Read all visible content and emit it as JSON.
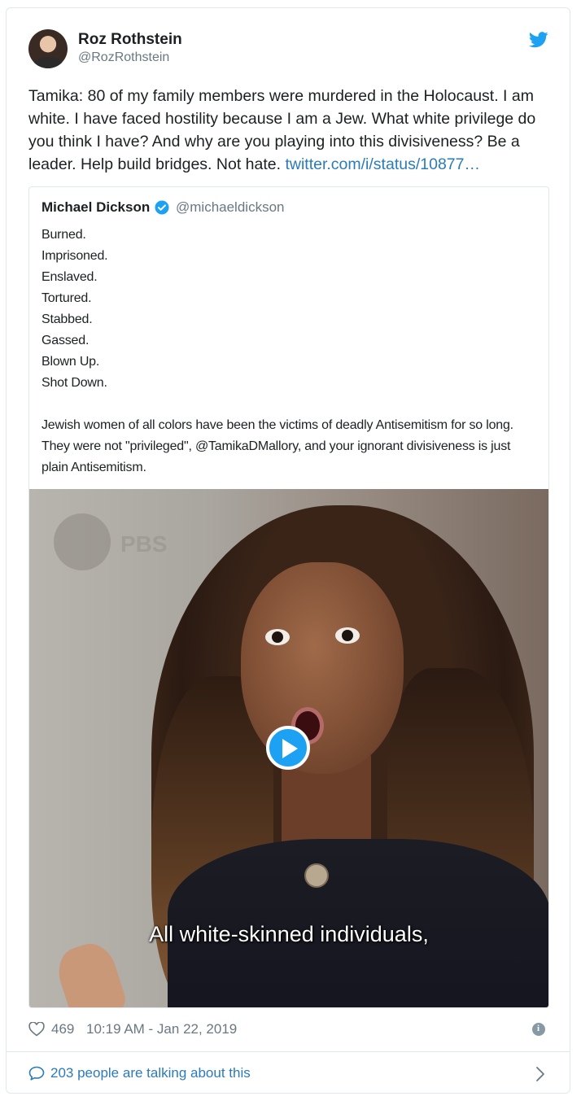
{
  "author": {
    "name": "Roz Rothstein",
    "handle": "@RozRothstein"
  },
  "tweet": {
    "text": "Tamika: 80 of my family members were murdered in the Holocaust. I am white. I have faced hostility because I am a Jew. What white privilege do you think I have? And why are you playing into this divisiveness? Be a leader. Help build bridges. Not hate. ",
    "link": "twitter.com/i/status/10877…"
  },
  "quoted": {
    "name": "Michael Dickson",
    "handle": "@michaeldickson",
    "lines": [
      "Burned.",
      "Imprisoned.",
      "Enslaved.",
      "Tortured.",
      "Stabbed.",
      "Gassed.",
      "Blown Up.",
      "Shot Down."
    ],
    "paragraph": "Jewish women of all colors have been the victims of deadly Antisemitism for so long. They were not \"privileged\", @TamikaDMallory, and your ignorant divisiveness is just plain Antisemitism.",
    "video_caption": "All white-skinned individuals,",
    "video_watermark": "PBS"
  },
  "footer": {
    "likes": "469",
    "timestamp": "10:19 AM - Jan 22, 2019",
    "talking": "203 people are talking about this"
  },
  "colors": {
    "link": "#2b7bb9",
    "brand": "#1da1f2",
    "muted": "#697882",
    "border": "#e1e8ed"
  },
  "icons": [
    "twitter-bird-icon",
    "verified-icon",
    "play-icon",
    "heart-icon",
    "info-icon",
    "speech-bubble-icon",
    "chevron-right-icon"
  ]
}
